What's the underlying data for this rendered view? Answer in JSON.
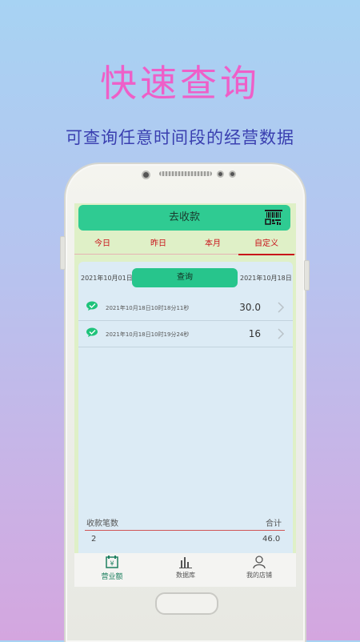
{
  "promo": {
    "headline": "快速查询",
    "subline": "可查询任意时间段的经营数据"
  },
  "app": {
    "title": "去收款",
    "tabs": [
      {
        "label": "今日",
        "active": false
      },
      {
        "label": "昨日",
        "active": false
      },
      {
        "label": "本月",
        "active": false
      },
      {
        "label": "自定义",
        "active": true
      }
    ],
    "query": {
      "start_date": "2021年10月01日",
      "end_date": "2021年10月18日",
      "button_label": "查询"
    },
    "records": [
      {
        "time": "2021年10月18日10时18分11秒",
        "amount": "30.0",
        "icon": "wechat-pay-icon"
      },
      {
        "time": "2021年10月18日10时19分24秒",
        "amount": "16",
        "icon": "wechat-pay-icon"
      }
    ],
    "summary": {
      "count_label": "收款笔数",
      "total_label": "合计",
      "count_value": "2",
      "total_value": "46.0"
    },
    "bottom_nav": [
      {
        "label": "营业额",
        "icon": "revenue-icon",
        "active": true
      },
      {
        "label": "数据库",
        "icon": "bar-chart-icon",
        "active": false
      },
      {
        "label": "我的店铺",
        "icon": "user-icon",
        "active": false
      }
    ]
  },
  "colors": {
    "accent_green": "#2fcb92",
    "tab_red": "#c8121a",
    "headline_pink": "#ee5fc8",
    "subline_blue": "#3a3fb0"
  }
}
